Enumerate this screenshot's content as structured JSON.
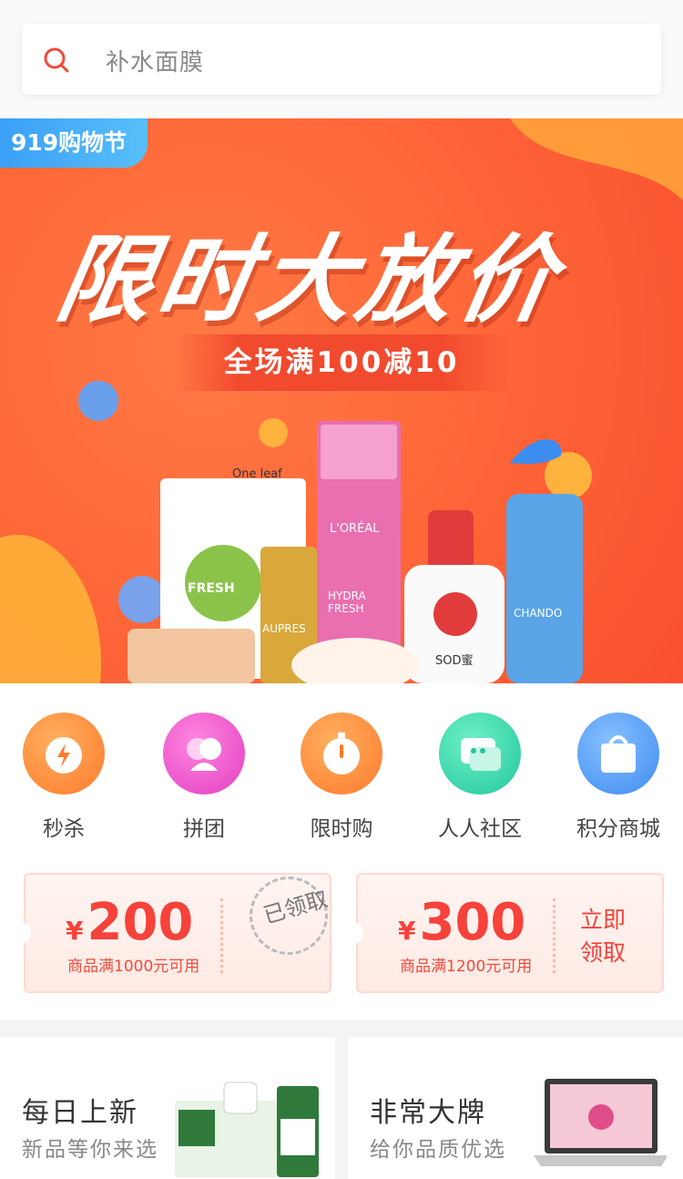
{
  "search": {
    "placeholder": "补水面膜"
  },
  "banner": {
    "tag": "919购物节",
    "headline": "限时大放价",
    "promo": "全场满100减10",
    "product_labels": [
      "One leaf",
      "FRESH",
      "L'ORÉAL",
      "HYDRA FRESH",
      "AUPRES",
      "SOD蜜",
      "CHANDO"
    ]
  },
  "categories": [
    {
      "label": "秒杀",
      "icon": "lightning-alarm-icon",
      "color": "#ff8a3c"
    },
    {
      "label": "拼团",
      "icon": "group-people-icon",
      "color": "#ef4fc8"
    },
    {
      "label": "限时购",
      "icon": "stopwatch-icon",
      "color": "#ff8a3c"
    },
    {
      "label": "人人社区",
      "icon": "chat-bubble-icon",
      "color": "#2fd1a5"
    },
    {
      "label": "积分商城",
      "icon": "shopping-bag-icon",
      "color": "#4d9bf5"
    }
  ],
  "coupons": [
    {
      "yen": "¥",
      "amount": "200",
      "condition": "商品满1000元可用",
      "status": "已领取"
    },
    {
      "yen": "¥",
      "amount": "300",
      "condition": "商品满1200元可用",
      "action_line1": "立即",
      "action_line2": "领取"
    }
  ],
  "features": [
    {
      "title": "每日上新",
      "subtitle": "新品等你来选"
    },
    {
      "title": "非常大牌",
      "subtitle": "给你品质优选"
    }
  ]
}
